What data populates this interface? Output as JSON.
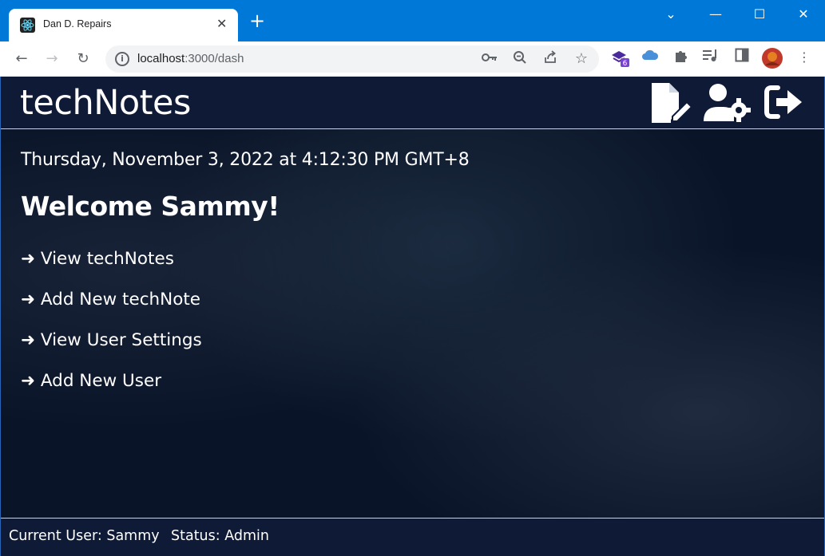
{
  "browser": {
    "tab_title": "Dan D. Repairs",
    "url_host": "localhost",
    "url_rest": ":3000/dash",
    "extension_badge": "6"
  },
  "app": {
    "title": "techNotes",
    "datetime": "Thursday, November 3, 2022 at 4:12:30 PM GMT+8",
    "welcome": "Welcome Sammy!",
    "links": [
      "➜ View techNotes",
      "➜ Add New techNote",
      "➜ View User Settings",
      "➜ Add New User"
    ],
    "footer": {
      "current_user": "Current User: Sammy",
      "status": "Status: Admin"
    },
    "header_icons": [
      "new-note-icon",
      "user-settings-icon",
      "logout-icon"
    ]
  },
  "colors": {
    "chrome_blue": "#0078d7",
    "app_bg": "#0a1428",
    "header_bg": "#0e1a36",
    "text": "#ffffff"
  }
}
